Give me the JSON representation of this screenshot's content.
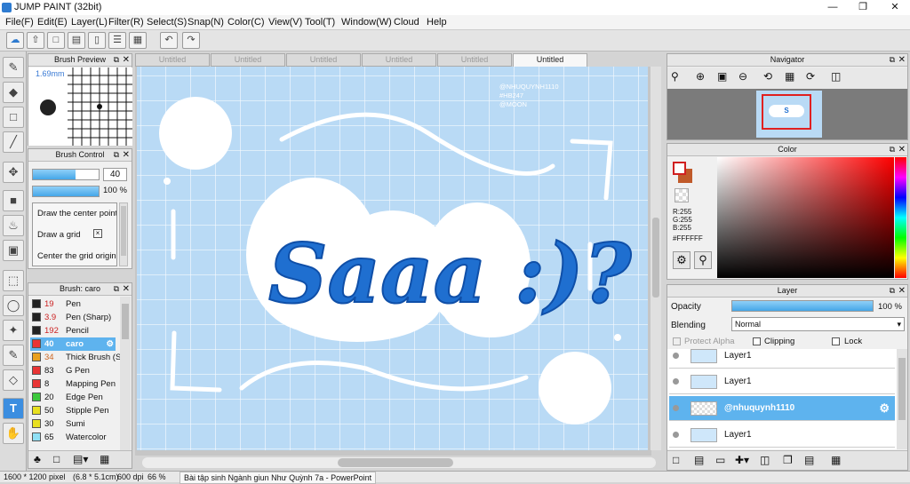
{
  "app": {
    "title": "JUMP PAINT (32bit)"
  },
  "menu": [
    "File(F)",
    "Edit(E)",
    "Layer(L)",
    "Filter(R)",
    "Select(S)",
    "Snap(N)",
    "Color(C)",
    "View(V)",
    "Tool(T)",
    "Window(W)",
    "Cloud",
    "Help"
  ],
  "brush_preview": {
    "title": "Brush Preview",
    "size": "1.69mm"
  },
  "brush_control": {
    "title": "Brush Control",
    "size_value": "40",
    "size_fill": 0.65,
    "opacity_value": "100 %",
    "opacity_fill": 1.0,
    "options": [
      "Draw the center point",
      "Draw a grid",
      "Center the grid origin"
    ]
  },
  "brush_list": {
    "title": "Brush: caro",
    "items": [
      {
        "num": "19",
        "name": "Pen",
        "color": "#222222",
        "numcolor": "#cc2222"
      },
      {
        "num": "3.9",
        "name": "Pen (Sharp)",
        "color": "#222222",
        "numcolor": "#cc2222"
      },
      {
        "num": "192",
        "name": "Pencil",
        "color": "#222222",
        "numcolor": "#cc2222"
      },
      {
        "num": "40",
        "name": "caro",
        "color": "#e83434",
        "numcolor": "#ffffff"
      },
      {
        "num": "34",
        "name": "Thick Brush (S",
        "color": "#e8a020",
        "numcolor": "#cc6622"
      },
      {
        "num": "83",
        "name": "G Pen",
        "color": "#e83434",
        "numcolor": "#111111"
      },
      {
        "num": "8",
        "name": "Mapping Pen",
        "color": "#e83434",
        "numcolor": "#111111"
      },
      {
        "num": "20",
        "name": "Edge Pen",
        "color": "#3cc83c",
        "numcolor": "#111111"
      },
      {
        "num": "50",
        "name": "Stipple Pen",
        "color": "#e8e020",
        "numcolor": "#111111"
      },
      {
        "num": "30",
        "name": "Sumi",
        "color": "#e8e020",
        "numcolor": "#111111"
      },
      {
        "num": "65",
        "name": "Watercolor",
        "color": "#8fe0f5",
        "numcolor": "#111111"
      }
    ]
  },
  "tabs": [
    "Untitled",
    "Untitled",
    "Untitled",
    "Untitled",
    "Untitled",
    "Untitled"
  ],
  "artwork": {
    "word": "Saaa :)?",
    "watermark": [
      "@NHUQUYNH1110",
      "#HB247",
      "@MOON"
    ]
  },
  "navigator": {
    "title": "Navigator"
  },
  "color": {
    "title": "Color",
    "r": "R:255",
    "g": "G:255",
    "b": "B:255",
    "hex": "#FFFFFF"
  },
  "layer": {
    "title": "Layer",
    "opacity_label": "Opacity",
    "opacity_value": "100 %",
    "opacity_fill": 1.0,
    "blending_label": "Blending",
    "blending_value": "Normal",
    "protect_alpha": "Protect Alpha",
    "clipping": "Clipping",
    "lock": "Lock",
    "items": [
      {
        "name": "Layer1"
      },
      {
        "name": "Layer1"
      },
      {
        "name": "@nhuquynh1110"
      },
      {
        "name": "Layer1"
      }
    ]
  },
  "status": {
    "size": "1600 * 1200 pixel",
    "cm": "(6.8 * 5.1cm)",
    "dpi": "600 dpi",
    "zoom": "66 %",
    "task": "Bài tập sinh Ngành giun Như Quỳnh 7a - PowerPoint"
  }
}
